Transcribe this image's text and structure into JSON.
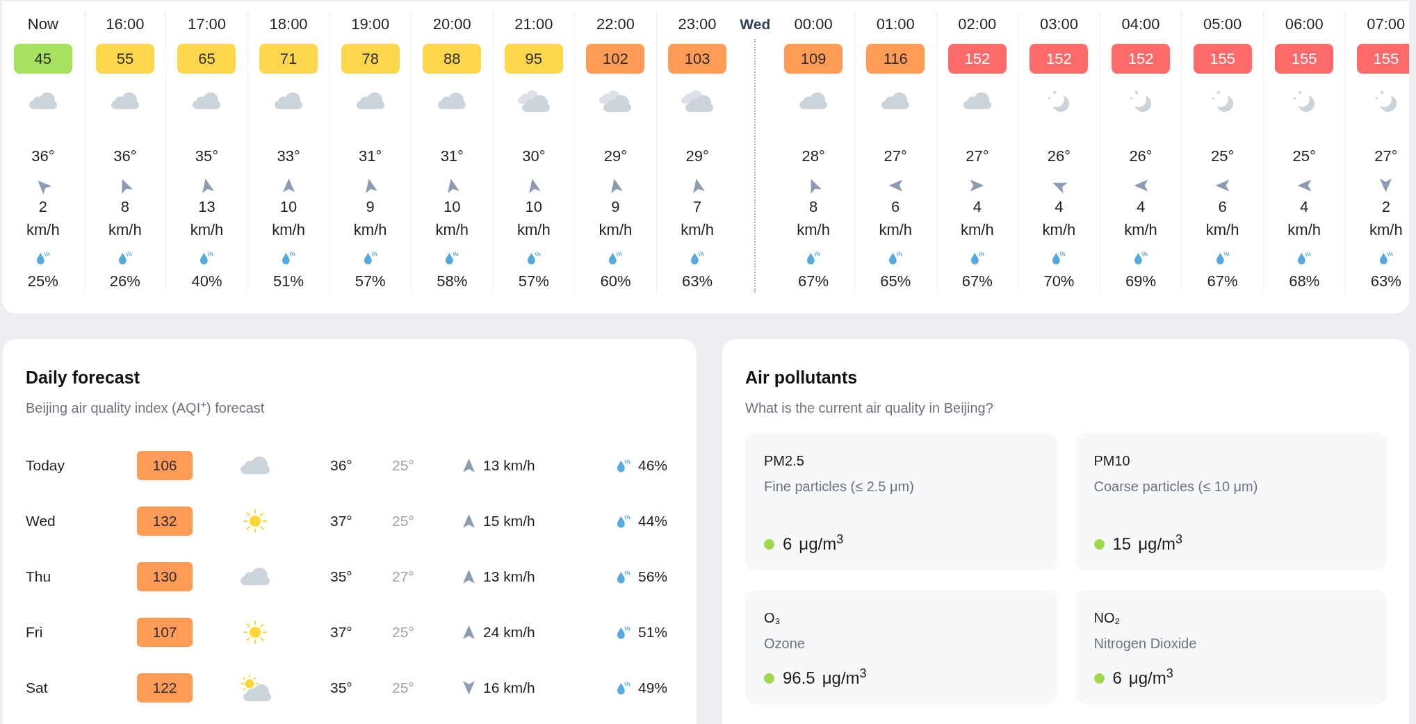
{
  "hourly": [
    {
      "kind": "hour",
      "time": "Now",
      "aqi": "45",
      "color": "#a8e05f",
      "weather_icon": {
        "kind": "cloudy"
      },
      "temperature": "36°",
      "wind_arrow": {
        "kind": "NW"
      },
      "wind_speed": "2",
      "wind_unit": "km/h",
      "humidity": "25%"
    },
    {
      "kind": "hour",
      "time": "16:00",
      "aqi": "55",
      "color": "#fdd74b",
      "weather_icon": {
        "kind": "cloudy"
      },
      "temperature": "36°",
      "wind_arrow": {
        "kind": "NNW"
      },
      "wind_speed": "8",
      "wind_unit": "km/h",
      "humidity": "26%"
    },
    {
      "kind": "hour",
      "time": "17:00",
      "aqi": "65",
      "color": "#fdd74b",
      "weather_icon": {
        "kind": "cloudy"
      },
      "temperature": "35°",
      "wind_arrow": {
        "kind": "NbW"
      },
      "wind_speed": "13",
      "wind_unit": "km/h",
      "humidity": "40%"
    },
    {
      "kind": "hour",
      "time": "18:00",
      "aqi": "71",
      "color": "#fdd74b",
      "weather_icon": {
        "kind": "cloudy"
      },
      "temperature": "33°",
      "wind_arrow": {
        "kind": "N"
      },
      "wind_speed": "10",
      "wind_unit": "km/h",
      "humidity": "51%"
    },
    {
      "kind": "hour",
      "time": "19:00",
      "aqi": "78",
      "color": "#fdd74b",
      "weather_icon": {
        "kind": "cloudy"
      },
      "temperature": "31°",
      "wind_arrow": {
        "kind": "NbW"
      },
      "wind_speed": "9",
      "wind_unit": "km/h",
      "humidity": "57%"
    },
    {
      "kind": "hour",
      "time": "20:00",
      "aqi": "88",
      "color": "#fdd74b",
      "weather_icon": {
        "kind": "cloudy"
      },
      "temperature": "31°",
      "wind_arrow": {
        "kind": "NbW"
      },
      "wind_speed": "10",
      "wind_unit": "km/h",
      "humidity": "58%"
    },
    {
      "kind": "hour",
      "time": "21:00",
      "aqi": "95",
      "color": "#fdd74b",
      "weather_icon": {
        "kind": "overcast"
      },
      "temperature": "30°",
      "wind_arrow": {
        "kind": "NbW"
      },
      "wind_speed": "10",
      "wind_unit": "km/h",
      "humidity": "57%"
    },
    {
      "kind": "hour",
      "time": "22:00",
      "aqi": "102",
      "color": "#fe9b57",
      "weather_icon": {
        "kind": "overcast"
      },
      "temperature": "29°",
      "wind_arrow": {
        "kind": "NbW"
      },
      "wind_speed": "9",
      "wind_unit": "km/h",
      "humidity": "60%"
    },
    {
      "kind": "hour",
      "time": "23:00",
      "aqi": "103",
      "color": "#fe9b57",
      "weather_icon": {
        "kind": "overcast"
      },
      "temperature": "29°",
      "wind_arrow": {
        "kind": "NbW"
      },
      "wind_speed": "7",
      "wind_unit": "km/h",
      "humidity": "63%"
    },
    {
      "kind": "day_divider",
      "label": "Wed"
    },
    {
      "kind": "hour",
      "time": "00:00",
      "aqi": "109",
      "color": "#fe9b57",
      "weather_icon": {
        "kind": "cloudy"
      },
      "temperature": "28°",
      "wind_arrow": {
        "kind": "NNW"
      },
      "wind_speed": "8",
      "wind_unit": "km/h",
      "humidity": "67%"
    },
    {
      "kind": "hour",
      "time": "01:00",
      "aqi": "116",
      "color": "#fe9b57",
      "weather_icon": {
        "kind": "cloudy"
      },
      "temperature": "27°",
      "wind_arrow": {
        "kind": "W"
      },
      "wind_speed": "6",
      "wind_unit": "km/h",
      "humidity": "65%"
    },
    {
      "kind": "hour",
      "time": "02:00",
      "aqi": "152",
      "color": "#fe6a69",
      "weather_icon": {
        "kind": "cloudy"
      },
      "temperature": "27°",
      "wind_arrow": {
        "kind": "E"
      },
      "wind_speed": "4",
      "wind_unit": "km/h",
      "humidity": "67%"
    },
    {
      "kind": "hour",
      "time": "03:00",
      "aqi": "152",
      "color": "#fe6a69",
      "weather_icon": {
        "kind": "clear_night"
      },
      "temperature": "26°",
      "wind_arrow": {
        "kind": "WNW"
      },
      "wind_speed": "4",
      "wind_unit": "km/h",
      "humidity": "70%"
    },
    {
      "kind": "hour",
      "time": "04:00",
      "aqi": "152",
      "color": "#fe6a69",
      "weather_icon": {
        "kind": "clear_night"
      },
      "temperature": "26°",
      "wind_arrow": {
        "kind": "W"
      },
      "wind_speed": "4",
      "wind_unit": "km/h",
      "humidity": "69%"
    },
    {
      "kind": "hour",
      "time": "05:00",
      "aqi": "155",
      "color": "#fe6a69",
      "weather_icon": {
        "kind": "clear_night"
      },
      "temperature": "25°",
      "wind_arrow": {
        "kind": "W"
      },
      "wind_speed": "6",
      "wind_unit": "km/h",
      "humidity": "67%"
    },
    {
      "kind": "hour",
      "time": "06:00",
      "aqi": "155",
      "color": "#fe6a69",
      "weather_icon": {
        "kind": "clear_night"
      },
      "temperature": "25°",
      "wind_arrow": {
        "kind": "W"
      },
      "wind_speed": "4",
      "wind_unit": "km/h",
      "humidity": "68%"
    },
    {
      "kind": "hour",
      "time": "07:00",
      "aqi": "155",
      "color": "#fe6a69",
      "weather_icon": {
        "kind": "clear_night"
      },
      "temperature": "27°",
      "wind_arrow": {
        "kind": "S"
      },
      "wind_speed": "2",
      "wind_unit": "km/h",
      "humidity": "63%"
    }
  ],
  "daily_forecast": {
    "title": "Daily forecast",
    "subtitle": "Beijing air quality index (AQI$^{+}$) forecast",
    "days": [
      {
        "day": "Today",
        "aqi": "106",
        "color": "#fe9b57",
        "weather_icon": {
          "kind": "cloudy"
        },
        "high": "36°",
        "low": "25°",
        "wind_arrow": {
          "kind": "N"
        },
        "wind": "13 km/h",
        "humidity": "46%"
      },
      {
        "day": "Wed",
        "aqi": "132",
        "color": "#fe9b57",
        "weather_icon": {
          "kind": "sunny"
        },
        "high": "37°",
        "low": "25°",
        "wind_arrow": {
          "kind": "N"
        },
        "wind": "15 km/h",
        "humidity": "44%"
      },
      {
        "day": "Thu",
        "aqi": "130",
        "color": "#fe9b57",
        "weather_icon": {
          "kind": "cloudy"
        },
        "high": "35°",
        "low": "27°",
        "wind_arrow": {
          "kind": "N"
        },
        "wind": "13 km/h",
        "humidity": "56%"
      },
      {
        "day": "Fri",
        "aqi": "107",
        "color": "#fe9b57",
        "weather_icon": {
          "kind": "sunny"
        },
        "high": "37°",
        "low": "25°",
        "wind_arrow": {
          "kind": "N"
        },
        "wind": "24 km/h",
        "humidity": "51%"
      },
      {
        "day": "Sat",
        "aqi": "122",
        "color": "#fe9b57",
        "weather_icon": {
          "kind": "partly_cloudy"
        },
        "high": "35°",
        "low": "25°",
        "wind_arrow": {
          "kind": "S"
        },
        "wind": "16 km/h",
        "humidity": "49%"
      }
    ]
  },
  "air_pollutants": {
    "title": "Air pollutants",
    "subtitle": "What is the current air quality in Beijing?",
    "pollutants": [
      {
        "name": "PM2.5",
        "description": "Fine particles (≤ 2.5 μm)",
        "value": "6",
        "unit": "μg/m$^{3}$",
        "color": "#9fd84f"
      },
      {
        "name": "PM10",
        "description": "Coarse particles (≤ 10 μm)",
        "value": "15",
        "unit": "μg/m$^{3}$",
        "color": "#9fd84f"
      },
      {
        "name": "O₃",
        "description": "Ozone",
        "value": "96.5",
        "unit": "μg/m$^{3}$",
        "color": "#9fd84f"
      },
      {
        "name": "NO₂",
        "description": "Nitrogen Dioxide",
        "value": "6",
        "unit": "μg/m$^{3}$",
        "color": "#9fd84f"
      }
    ]
  }
}
